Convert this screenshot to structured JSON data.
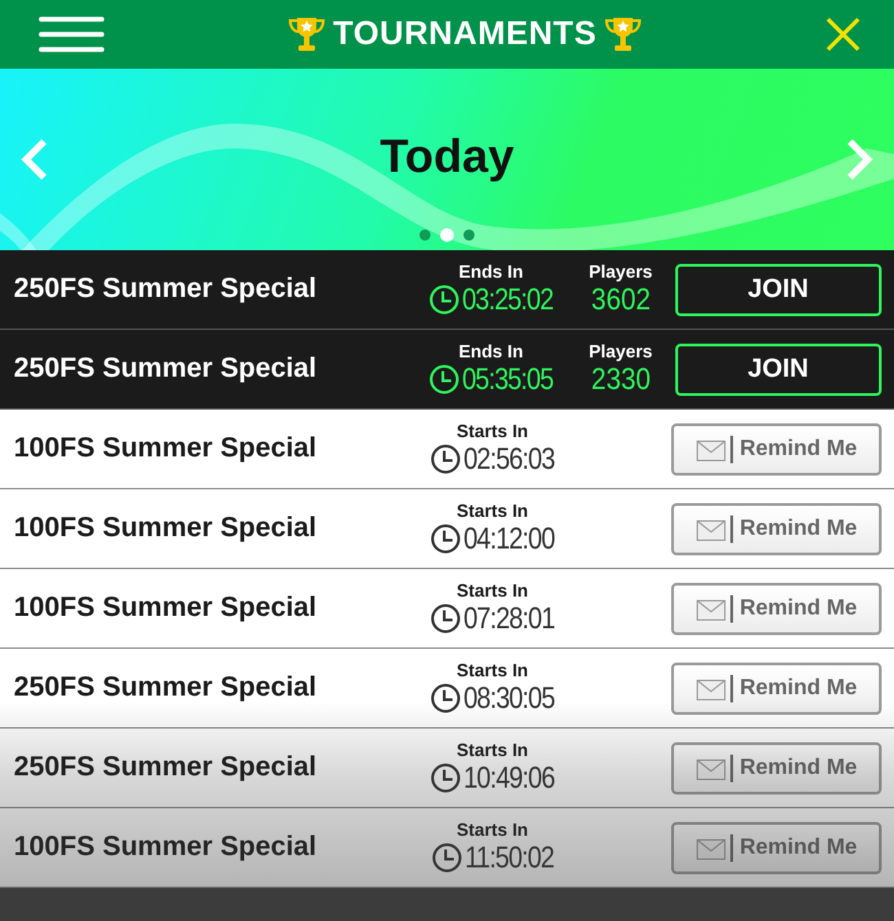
{
  "header": {
    "title": "TOURNAMENTS"
  },
  "banner": {
    "title": "Today",
    "pages": [
      {
        "selected": false
      },
      {
        "selected": true
      },
      {
        "selected": false
      }
    ]
  },
  "tournaments": [
    {
      "kind": "live",
      "name": "250FS Summer Special",
      "timer_label": "Ends In",
      "time": "03:25:02",
      "players_label": "Players",
      "players": "3602",
      "button": "JOIN"
    },
    {
      "kind": "live",
      "name": "250FS Summer Special",
      "timer_label": "Ends In",
      "time": "05:35:05",
      "players_label": "Players",
      "players": "2330",
      "button": "JOIN"
    },
    {
      "kind": "upcoming",
      "name": "100FS Summer Special",
      "timer_label": "Starts In",
      "time": "02:56:03",
      "button": "Remind Me"
    },
    {
      "kind": "upcoming",
      "name": "100FS Summer Special",
      "timer_label": "Starts In",
      "time": "04:12:00",
      "button": "Remind Me"
    },
    {
      "kind": "upcoming",
      "name": "100FS Summer Special",
      "timer_label": "Starts In",
      "time": "07:28:01",
      "button": "Remind Me"
    },
    {
      "kind": "upcoming",
      "name": "250FS Summer Special",
      "timer_label": "Starts In",
      "time": "08:30:05",
      "button": "Remind Me"
    },
    {
      "kind": "upcoming",
      "name": "250FS Summer Special",
      "timer_label": "Starts In",
      "time": "10:49:06",
      "button": "Remind Me"
    },
    {
      "kind": "upcoming",
      "name": "100FS Summer Special",
      "timer_label": "Starts In",
      "time": "11:50:02",
      "button": "Remind Me"
    }
  ]
}
